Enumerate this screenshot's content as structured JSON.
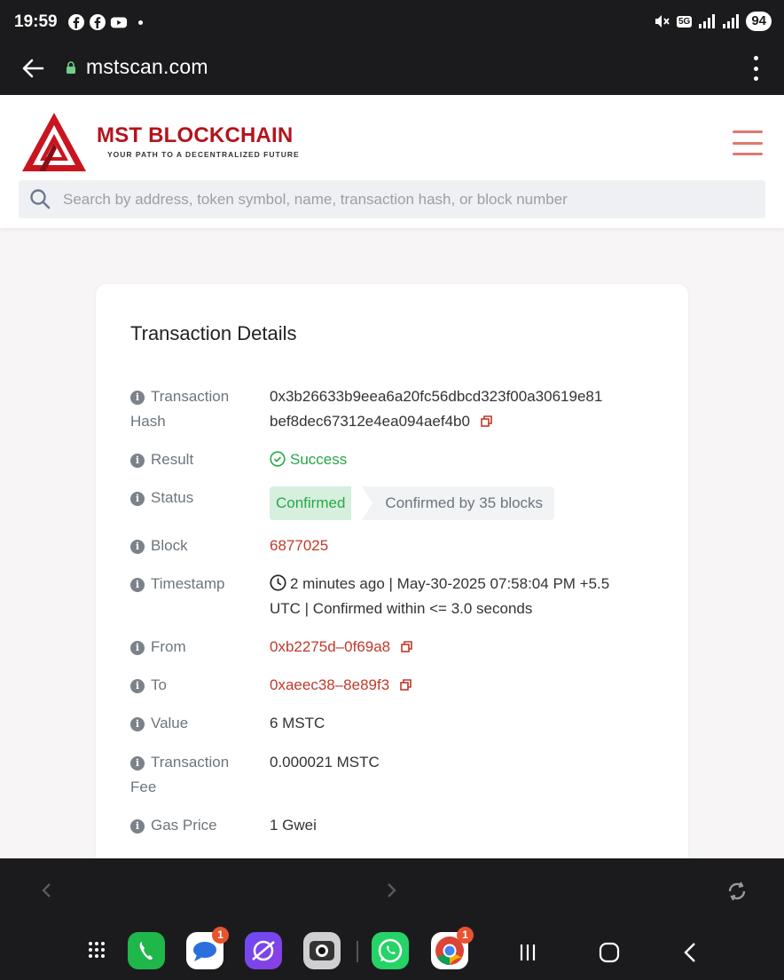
{
  "status_bar": {
    "time": "19:59",
    "network": "5G",
    "battery": "94",
    "app_icons": [
      "facebook-icon",
      "facebook-icon",
      "youtube-icon"
    ]
  },
  "browser": {
    "url": "mstscan.com"
  },
  "site": {
    "brand": "MST BLOCKCHAIN",
    "tagline": "YOUR PATH TO A DECENTRALIZED FUTURE",
    "search_placeholder": "Search by address, token symbol, name, transaction hash, or block number",
    "accent_color": "#b3141c"
  },
  "transaction": {
    "title": "Transaction Details",
    "hash": {
      "label_line1": "Transaction",
      "label_line2": "Hash",
      "value_line1": "0x3b26633b9eea6a20fc56dbcd323f00a30619e81",
      "value_line2": "bef8dec67312e4ea094aef4b0"
    },
    "result": {
      "label": "Result",
      "value": "Success"
    },
    "status": {
      "label": "Status",
      "confirmed": "Confirmed",
      "blocks": "Confirmed by 35 blocks"
    },
    "block": {
      "label": "Block",
      "value": "6877025"
    },
    "timestamp": {
      "label": "Timestamp",
      "value_line1": "2 minutes ago | May-30-2025 07:58:04 PM +5.5",
      "value_line2": "UTC | Confirmed within <= 3.0 seconds"
    },
    "from": {
      "label": "From",
      "value": "0xb2275d–0f69a8"
    },
    "to": {
      "label": "To",
      "value": "0xaeec38–8e89f3"
    },
    "value": {
      "label": "Value",
      "value": "6 MSTC"
    },
    "fee": {
      "label_line1": "Transaction",
      "label_line2": "Fee",
      "value": "0.000021 MSTC"
    },
    "gas_price": {
      "label": "Gas Price",
      "value": "1 Gwei"
    }
  },
  "dock": {
    "apps": [
      "apps-grid-icon",
      "phone-icon",
      "messages-icon",
      "internet-icon",
      "camera-icon",
      "whatsapp-icon",
      "chrome-icon"
    ],
    "messages_badge": "1",
    "chrome_badge": "1"
  }
}
